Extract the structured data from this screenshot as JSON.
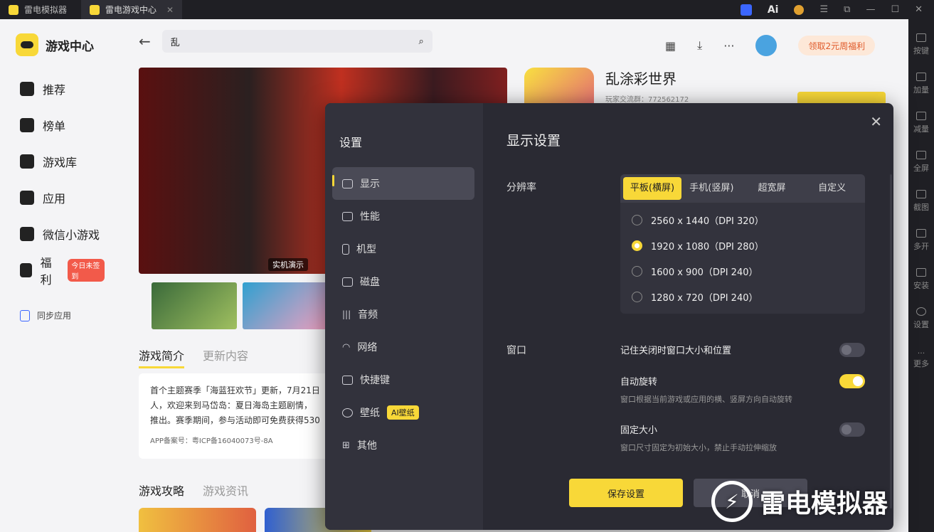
{
  "titlebar": {
    "tabs": [
      {
        "label": "雷电模拟器"
      },
      {
        "label": "雷电游戏中心"
      }
    ],
    "ai_label": "Ai"
  },
  "right_toolbar": {
    "items": [
      "按键",
      "加量",
      "减量",
      "全屏",
      "截图",
      "多开",
      "安装",
      "设置",
      "更多"
    ]
  },
  "left_nav": {
    "brand": "游戏中心",
    "items": [
      {
        "label": "推荐",
        "icon": "home-icon"
      },
      {
        "label": "榜单",
        "icon": "chart-icon"
      },
      {
        "label": "游戏库",
        "icon": "gamepad-icon"
      },
      {
        "label": "应用",
        "icon": "apps-icon"
      },
      {
        "label": "微信小游戏",
        "icon": "wechat-game-icon"
      },
      {
        "label": "福利",
        "icon": "gift-icon",
        "badge": "今日未签到"
      }
    ],
    "sync": "同步应用"
  },
  "main": {
    "search_value": "乱",
    "promo": "领取2元周福利",
    "hero_tag": "实机演示",
    "tabs1": [
      "游戏简介",
      "更新内容"
    ],
    "intro_lines": [
      "首个主题赛季「海蓝狂欢节」更新，7月21日",
      "人，欢迎来到马岱岛：夏日海岛主题剧情，",
      "推出。赛季期间，参与活动即可免费获得530"
    ],
    "icp": "APP备案号：粤ICP备16040073号-8A",
    "tabs2": [
      "游戏攻略",
      "游戏资讯"
    ],
    "game_title": "乱涂彩世界",
    "game_group": "玩家交流群：772562172"
  },
  "dialog": {
    "left_title": "设置",
    "menu": [
      {
        "label": "显示",
        "icon": "monitor-icon"
      },
      {
        "label": "性能",
        "icon": "performance-icon"
      },
      {
        "label": "机型",
        "icon": "phone-icon"
      },
      {
        "label": "磁盘",
        "icon": "disk-icon"
      },
      {
        "label": "音频",
        "icon": "audio-icon"
      },
      {
        "label": "网络",
        "icon": "wifi-icon"
      },
      {
        "label": "快捷键",
        "icon": "keyboard-icon"
      },
      {
        "label": "壁纸",
        "icon": "palette-icon",
        "badge": "AI壁纸"
      },
      {
        "label": "其他",
        "icon": "grid-icon"
      }
    ],
    "title": "显示设置",
    "resolution_label": "分辨率",
    "resolution_tabs": [
      "平板(横屏)",
      "手机(竖屏)",
      "超宽屏",
      "自定义"
    ],
    "resolution_options": [
      {
        "label": "2560 x 1440（DPI 320）",
        "selected": false
      },
      {
        "label": "1920 x 1080（DPI 280）",
        "selected": true
      },
      {
        "label": "1600 x 900（DPI 240）",
        "selected": false
      },
      {
        "label": "1280 x 720（DPI 240）",
        "selected": false
      }
    ],
    "window_label": "窗口",
    "window_options": [
      {
        "title": "记住关闭时窗口大小和位置",
        "desc": "",
        "on": false
      },
      {
        "title": "自动旋转",
        "desc": "窗口根据当前游戏或应用的横、竖屏方向自动旋转",
        "on": true
      },
      {
        "title": "固定大小",
        "desc": "窗口尺寸固定为初始大小，禁止手动拉伸缩放",
        "on": false
      }
    ],
    "save_label": "保存设置",
    "cancel_label": "取消"
  },
  "watermark": "雷电模拟器",
  "colors": {
    "accent": "#f8d838",
    "dialog_bg": "#2a2a33"
  }
}
